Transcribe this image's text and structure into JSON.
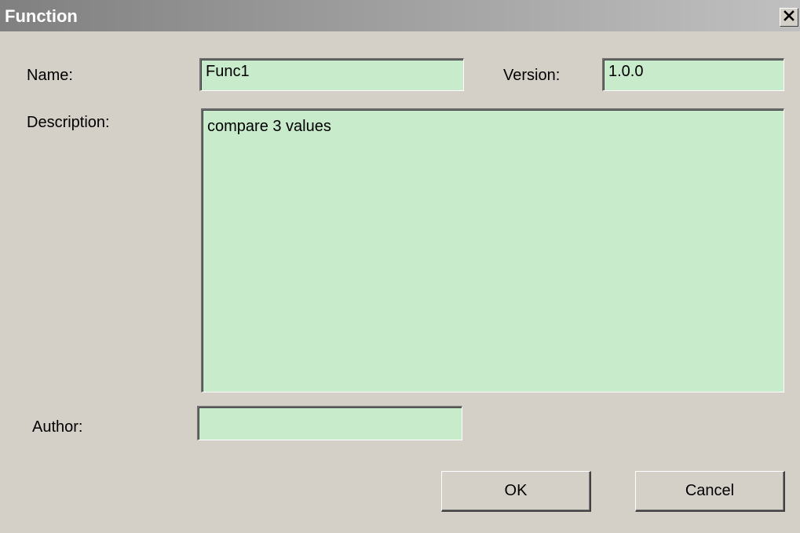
{
  "window": {
    "title": "Function"
  },
  "form": {
    "name_label": "Name:",
    "name_value": "Func1",
    "version_label": "Version:",
    "version_value": "1.0.0",
    "description_label": "Description:",
    "description_value": "compare 3 values",
    "author_label": "Author:",
    "author_value": ""
  },
  "buttons": {
    "ok_label": "OK",
    "cancel_label": "Cancel"
  },
  "colors": {
    "field_background": "#c8ebcc",
    "dialog_background": "#d4d0c8",
    "titlebar_start": "#808080",
    "titlebar_end": "#c0c0c0"
  },
  "icons": {
    "close": "close-icon"
  }
}
